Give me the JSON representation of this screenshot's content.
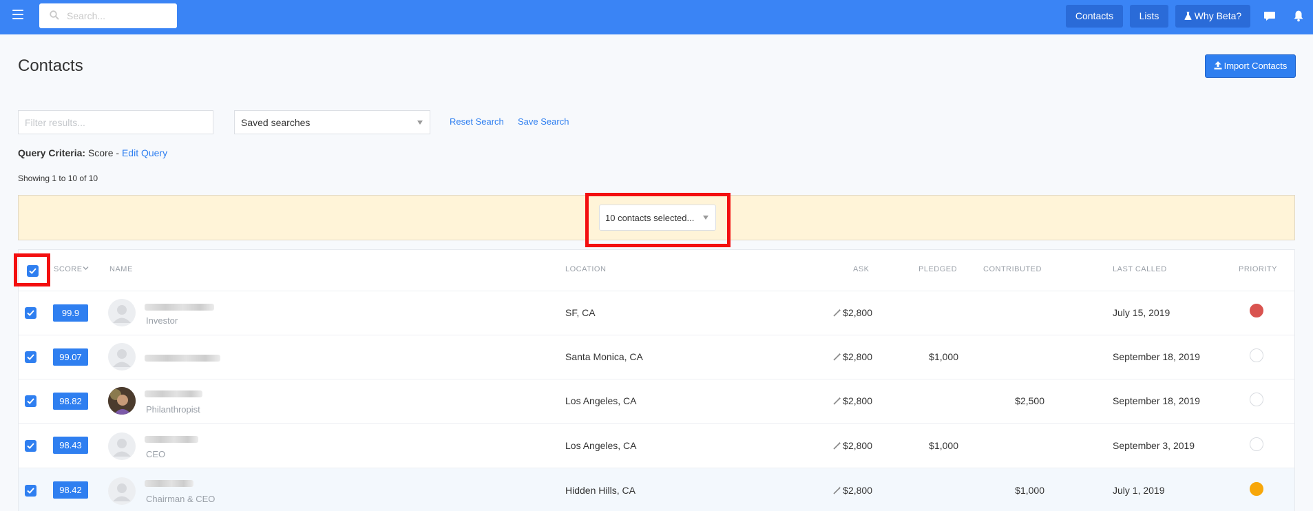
{
  "nav": {
    "search_placeholder": "Search...",
    "contacts_label": "Contacts",
    "lists_label": "Lists",
    "why_beta_label": "Why Beta?"
  },
  "page": {
    "title": "Contacts",
    "import_label": "Import Contacts"
  },
  "filters": {
    "filter_placeholder": "Filter results...",
    "saved_searches_value": "Saved searches",
    "reset_label": "Reset Search",
    "save_label": "Save Search"
  },
  "query": {
    "prefix": "Query Criteria:",
    "criteria": "Score -",
    "edit_label": "Edit Query"
  },
  "showing": "Showing 1 to 10 of 10",
  "bulk": {
    "selected_value": "10 contacts selected..."
  },
  "table": {
    "headers": {
      "score": "SCORE",
      "name": "NAME",
      "location": "LOCATION",
      "ask": "ASK",
      "pledged": "PLEDGED",
      "contributed": "CONTRIBUTED",
      "last_called": "LAST CALLED",
      "priority": "PRIORITY"
    },
    "rows": [
      {
        "score": "99.9",
        "title": "Investor",
        "location": "SF, CA",
        "ask": "$2,800",
        "pledged": "",
        "contributed": "",
        "last_called": "July 15, 2019",
        "priority": "high"
      },
      {
        "score": "99.07",
        "title": "",
        "location": "Santa Monica, CA",
        "ask": "$2,800",
        "pledged": "$1,000",
        "contributed": "",
        "last_called": "September 18, 2019",
        "priority": "none"
      },
      {
        "score": "98.82",
        "title": "Philanthropist",
        "location": "Los Angeles, CA",
        "ask": "$2,800",
        "pledged": "",
        "contributed": "$2,500",
        "last_called": "September 18, 2019",
        "priority": "none"
      },
      {
        "score": "98.43",
        "title": "CEO",
        "location": "Los Angeles, CA",
        "ask": "$2,800",
        "pledged": "$1,000",
        "contributed": "",
        "last_called": "September 3, 2019",
        "priority": "none"
      },
      {
        "score": "98.42",
        "title": "Chairman & CEO",
        "location": "Hidden Hills, CA",
        "ask": "$2,800",
        "pledged": "",
        "contributed": "$1,000",
        "last_called": "July 1, 2019",
        "priority": "medium"
      }
    ]
  },
  "colors": {
    "nav": "#3a84f5",
    "accent": "#2f7ff0",
    "priority_high": "#d9534f",
    "priority_medium": "#f7a70a",
    "highlight": "#f30f0f"
  }
}
